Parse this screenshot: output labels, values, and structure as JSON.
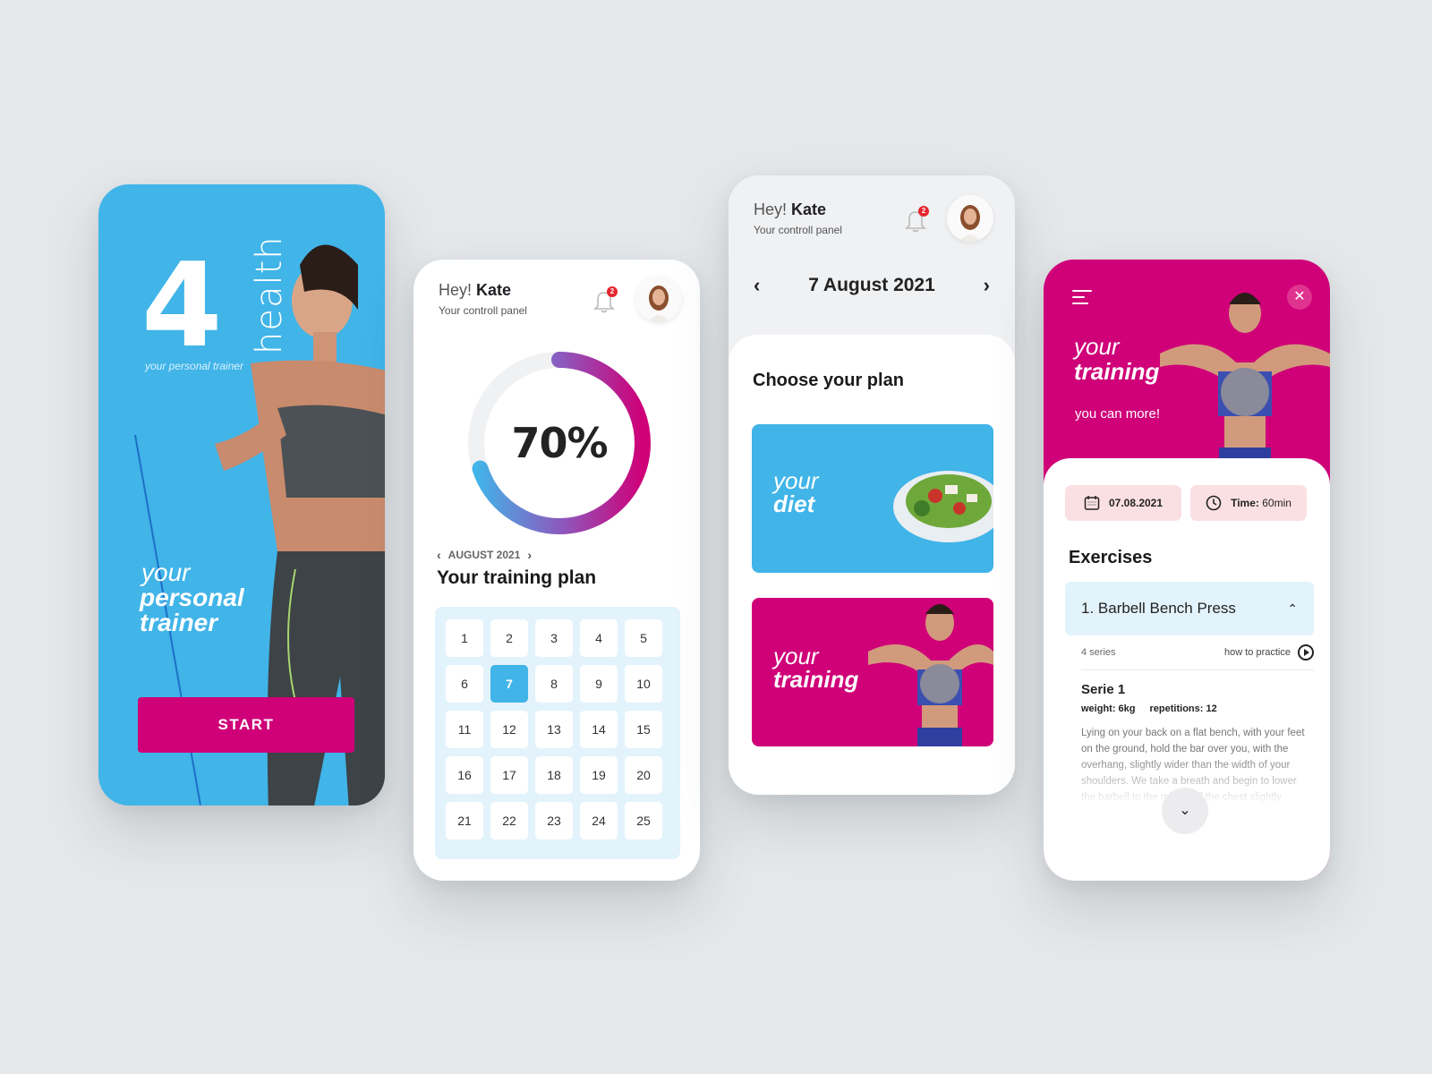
{
  "colors": {
    "brand_blue": "#41b4e8",
    "brand_magenta": "#cf0078",
    "background": "#e5e8ea"
  },
  "splash": {
    "logo_number": "4",
    "logo_word": "health",
    "tagline": "your personal trainer",
    "headline_line1": "your",
    "headline_line2": "personal",
    "headline_line3": "trainer",
    "start_label": "START"
  },
  "user": {
    "greeting": "Hey!",
    "name": "Kate",
    "subtitle": "Your controll panel",
    "notifications": "2"
  },
  "dashboard": {
    "progress_percent": 70,
    "progress_label": "70%",
    "month_label": "AUGUST 2021",
    "plan_title": "Your training plan",
    "selected_day": 7,
    "days": [
      1,
      2,
      3,
      4,
      5,
      6,
      7,
      8,
      9,
      10,
      11,
      12,
      13,
      14,
      15,
      16,
      17,
      18,
      19,
      20,
      21,
      22,
      23,
      24,
      25
    ]
  },
  "choose_plan": {
    "date": "7 August 2021",
    "title": "Choose your plan",
    "cards": [
      {
        "line1": "your",
        "line2": "diet"
      },
      {
        "line1": "your",
        "line2": "training"
      }
    ]
  },
  "training": {
    "title_line1": "your",
    "title_line2": "training",
    "slogan": "you can more!",
    "date": "07.08.2021",
    "time_label": "Time:",
    "time_value": "60min",
    "exercises_title": "Exercises",
    "exercise": {
      "name": "1. Barbell Bench Press",
      "series": "4 series",
      "how_to": "how to practice",
      "serie_title": "Serie 1",
      "weight": "weight: 6kg",
      "repetitions": "repetitions: 12",
      "description": "Lying on your back on a flat bench, with your feet on the ground, hold the bar over you, with the overhang, slightly wider than the width of your shoulders. We take a breath and begin to lower the barbell to the middle of the chest slightly below the"
    }
  }
}
